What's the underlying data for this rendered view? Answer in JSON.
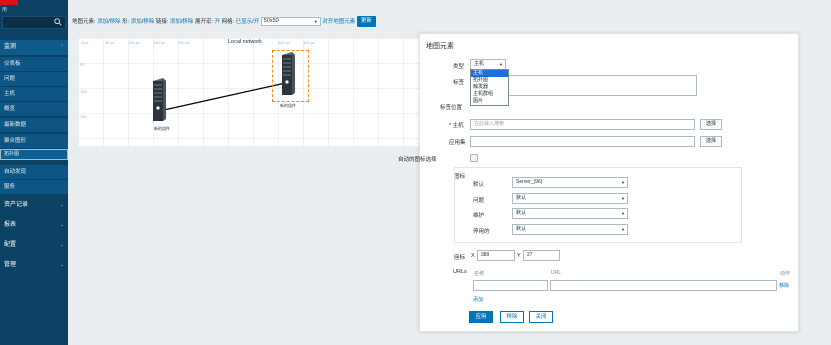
{
  "sidebar": {
    "brand_sub": "用",
    "groups": [
      {
        "label": "监测"
      },
      {
        "label": "资产记录"
      },
      {
        "label": "报表"
      },
      {
        "label": "配置"
      },
      {
        "label": "管理"
      }
    ],
    "items": [
      {
        "label": "仪表板"
      },
      {
        "label": "问题"
      },
      {
        "label": "主机"
      },
      {
        "label": "概览"
      },
      {
        "label": "最新数据"
      },
      {
        "label": "聚合图形"
      },
      {
        "label": "拓扑图"
      },
      {
        "label": "自动发现"
      },
      {
        "label": "服务"
      }
    ]
  },
  "toolbar": {
    "map_element_label": "地图元素:",
    "add1": "添加",
    "sep": "/",
    "remove1": "移除",
    "shape_label": "形:",
    "add2": "添加",
    "remove2": "移除",
    "link_label": "链接:",
    "add3": "添加",
    "remove3": "移除",
    "expand_label": "展开宏:",
    "expand_value": "开",
    "grid_label": "网格:",
    "grid_shown": "已显示",
    "grid_on": "开",
    "grid_size": "50x50",
    "align_label": "对齐地图元素",
    "update_btn": "更新"
  },
  "canvas": {
    "title": "Local network",
    "ticks_x": [
      "0 px",
      "50 px",
      "100 px",
      "150 px",
      "200 px",
      "250 px",
      "300 px"
    ],
    "ticks_y": [
      "50",
      "100",
      "150"
    ],
    "servers": [
      {
        "label": "新的组件"
      },
      {
        "label": "新的组件"
      }
    ]
  },
  "dialog": {
    "title": "地图元素",
    "type_label": "类型",
    "type_value": "主机",
    "type_options": [
      "主机",
      "拓扑图",
      "触发器",
      "主机群组",
      "图片"
    ],
    "label_label": "标签",
    "label_pos_label": "标签位置",
    "host_label": "* 主机",
    "host_placeholder": "在此输入搜索",
    "select_btn": "选择",
    "app_label": "应用集",
    "auto_icon_label": "自动的图标选择",
    "icons_label": "图标",
    "default_label": "默认",
    "default_value": "Server_(96)",
    "problem_label": "问题",
    "problem_value": "默认",
    "maint_label": "维护",
    "maint_value": "默认",
    "disabled_label": "停用的",
    "disabled_value": "默认",
    "coords_label": "座标",
    "x_label": "X",
    "x_value": "389",
    "y_label": "Y",
    "y_value": "27",
    "urls_label": "URLs",
    "col_name": "名称",
    "col_url": "URL",
    "col_action": "动作",
    "remove_link": "移除",
    "add_link": "添加",
    "apply_btn": "应用",
    "remove_btn": "移除",
    "close_btn": "关闭"
  }
}
